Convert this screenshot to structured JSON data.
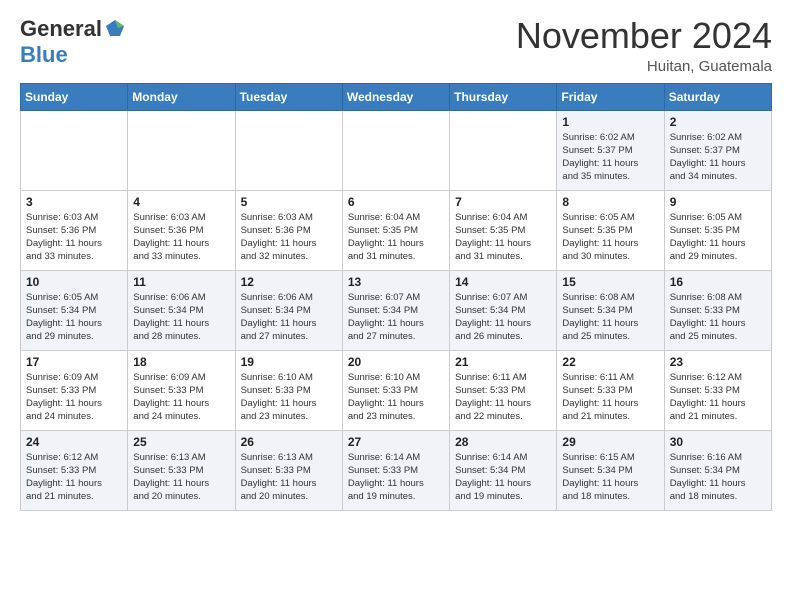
{
  "header": {
    "logo_general": "General",
    "logo_blue": "Blue",
    "month_title": "November 2024",
    "location": "Huitan, Guatemala"
  },
  "calendar": {
    "days_of_week": [
      "Sunday",
      "Monday",
      "Tuesday",
      "Wednesday",
      "Thursday",
      "Friday",
      "Saturday"
    ],
    "weeks": [
      [
        {
          "day": "",
          "info": ""
        },
        {
          "day": "",
          "info": ""
        },
        {
          "day": "",
          "info": ""
        },
        {
          "day": "",
          "info": ""
        },
        {
          "day": "",
          "info": ""
        },
        {
          "day": "1",
          "info": "Sunrise: 6:02 AM\nSunset: 5:37 PM\nDaylight: 11 hours\nand 35 minutes."
        },
        {
          "day": "2",
          "info": "Sunrise: 6:02 AM\nSunset: 5:37 PM\nDaylight: 11 hours\nand 34 minutes."
        }
      ],
      [
        {
          "day": "3",
          "info": "Sunrise: 6:03 AM\nSunset: 5:36 PM\nDaylight: 11 hours\nand 33 minutes."
        },
        {
          "day": "4",
          "info": "Sunrise: 6:03 AM\nSunset: 5:36 PM\nDaylight: 11 hours\nand 33 minutes."
        },
        {
          "day": "5",
          "info": "Sunrise: 6:03 AM\nSunset: 5:36 PM\nDaylight: 11 hours\nand 32 minutes."
        },
        {
          "day": "6",
          "info": "Sunrise: 6:04 AM\nSunset: 5:35 PM\nDaylight: 11 hours\nand 31 minutes."
        },
        {
          "day": "7",
          "info": "Sunrise: 6:04 AM\nSunset: 5:35 PM\nDaylight: 11 hours\nand 31 minutes."
        },
        {
          "day": "8",
          "info": "Sunrise: 6:05 AM\nSunset: 5:35 PM\nDaylight: 11 hours\nand 30 minutes."
        },
        {
          "day": "9",
          "info": "Sunrise: 6:05 AM\nSunset: 5:35 PM\nDaylight: 11 hours\nand 29 minutes."
        }
      ],
      [
        {
          "day": "10",
          "info": "Sunrise: 6:05 AM\nSunset: 5:34 PM\nDaylight: 11 hours\nand 29 minutes."
        },
        {
          "day": "11",
          "info": "Sunrise: 6:06 AM\nSunset: 5:34 PM\nDaylight: 11 hours\nand 28 minutes."
        },
        {
          "day": "12",
          "info": "Sunrise: 6:06 AM\nSunset: 5:34 PM\nDaylight: 11 hours\nand 27 minutes."
        },
        {
          "day": "13",
          "info": "Sunrise: 6:07 AM\nSunset: 5:34 PM\nDaylight: 11 hours\nand 27 minutes."
        },
        {
          "day": "14",
          "info": "Sunrise: 6:07 AM\nSunset: 5:34 PM\nDaylight: 11 hours\nand 26 minutes."
        },
        {
          "day": "15",
          "info": "Sunrise: 6:08 AM\nSunset: 5:34 PM\nDaylight: 11 hours\nand 25 minutes."
        },
        {
          "day": "16",
          "info": "Sunrise: 6:08 AM\nSunset: 5:33 PM\nDaylight: 11 hours\nand 25 minutes."
        }
      ],
      [
        {
          "day": "17",
          "info": "Sunrise: 6:09 AM\nSunset: 5:33 PM\nDaylight: 11 hours\nand 24 minutes."
        },
        {
          "day": "18",
          "info": "Sunrise: 6:09 AM\nSunset: 5:33 PM\nDaylight: 11 hours\nand 24 minutes."
        },
        {
          "day": "19",
          "info": "Sunrise: 6:10 AM\nSunset: 5:33 PM\nDaylight: 11 hours\nand 23 minutes."
        },
        {
          "day": "20",
          "info": "Sunrise: 6:10 AM\nSunset: 5:33 PM\nDaylight: 11 hours\nand 23 minutes."
        },
        {
          "day": "21",
          "info": "Sunrise: 6:11 AM\nSunset: 5:33 PM\nDaylight: 11 hours\nand 22 minutes."
        },
        {
          "day": "22",
          "info": "Sunrise: 6:11 AM\nSunset: 5:33 PM\nDaylight: 11 hours\nand 21 minutes."
        },
        {
          "day": "23",
          "info": "Sunrise: 6:12 AM\nSunset: 5:33 PM\nDaylight: 11 hours\nand 21 minutes."
        }
      ],
      [
        {
          "day": "24",
          "info": "Sunrise: 6:12 AM\nSunset: 5:33 PM\nDaylight: 11 hours\nand 21 minutes."
        },
        {
          "day": "25",
          "info": "Sunrise: 6:13 AM\nSunset: 5:33 PM\nDaylight: 11 hours\nand 20 minutes."
        },
        {
          "day": "26",
          "info": "Sunrise: 6:13 AM\nSunset: 5:33 PM\nDaylight: 11 hours\nand 20 minutes."
        },
        {
          "day": "27",
          "info": "Sunrise: 6:14 AM\nSunset: 5:33 PM\nDaylight: 11 hours\nand 19 minutes."
        },
        {
          "day": "28",
          "info": "Sunrise: 6:14 AM\nSunset: 5:34 PM\nDaylight: 11 hours\nand 19 minutes."
        },
        {
          "day": "29",
          "info": "Sunrise: 6:15 AM\nSunset: 5:34 PM\nDaylight: 11 hours\nand 18 minutes."
        },
        {
          "day": "30",
          "info": "Sunrise: 6:16 AM\nSunset: 5:34 PM\nDaylight: 11 hours\nand 18 minutes."
        }
      ]
    ]
  }
}
